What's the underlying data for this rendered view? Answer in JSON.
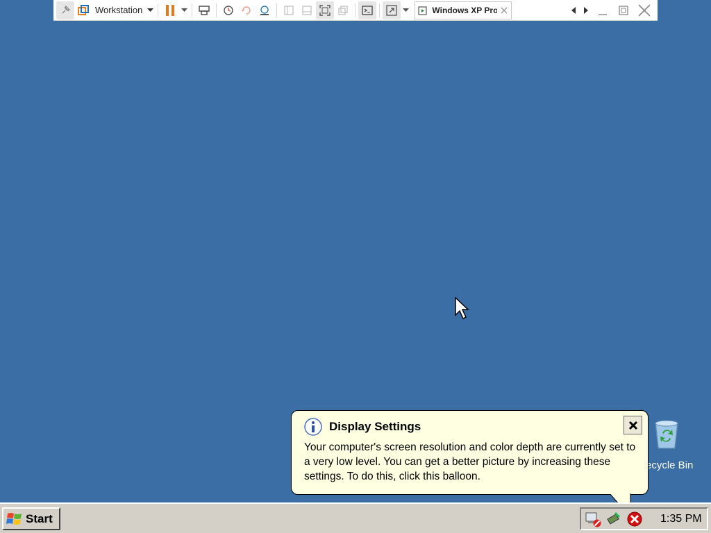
{
  "toolbar": {
    "library_label": "Workstation",
    "tab_title": "Windows XP Pro...",
    "icons": [
      "pin-icon",
      "vmware-logo-icon",
      "pause-icon",
      "send-ctrl-alt-del-icon",
      "snapshot-icon",
      "revert-snapshot-icon",
      "snapshot-manager-icon",
      "library-view-icon",
      "thumbnail-view-icon",
      "fullscreen-icon",
      "unity-icon",
      "console-icon",
      "stretch-icon"
    ]
  },
  "desktop": {
    "background_color": "#3a6ea5",
    "recycle_bin_label": "ecycle Bin"
  },
  "balloon": {
    "title": "Display Settings",
    "body": "Your computer's screen resolution and color depth are currently set to a very low level. You can get a better picture by increasing these settings. To do this, click this balloon.",
    "background_color": "#ffffe1"
  },
  "taskbar": {
    "start_label": "Start",
    "clock": "1:35 PM",
    "tray_icons": [
      "network-disconnected-icon",
      "safely-remove-hardware-icon",
      "security-alert-icon"
    ]
  }
}
